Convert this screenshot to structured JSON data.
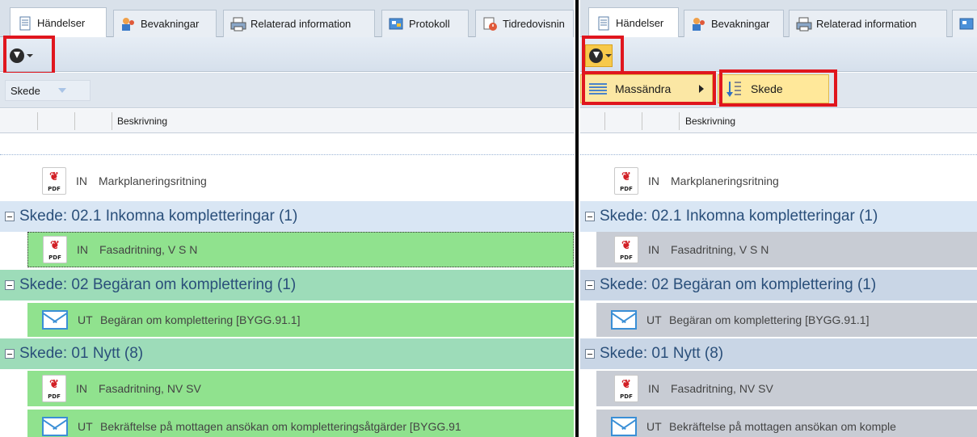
{
  "tabs_left": [
    {
      "label": "Händelser",
      "icon": "events-icon"
    },
    {
      "label": "Bevakningar",
      "icon": "watchers-icon"
    },
    {
      "label": "Relaterad information",
      "icon": "printer-icon"
    },
    {
      "label": "Protokoll",
      "icon": "protocol-icon"
    },
    {
      "label": "Tidredovisnin",
      "icon": "time-report-icon"
    }
  ],
  "tabs_right": [
    {
      "label": "Händelser",
      "icon": "events-icon"
    },
    {
      "label": "Bevakningar",
      "icon": "watchers-icon"
    },
    {
      "label": "Relaterad information",
      "icon": "printer-icon"
    }
  ],
  "group_chip": "Skede",
  "column_header": "Beskrivning",
  "menu": {
    "item1": "Massändra",
    "item2": "Skede"
  },
  "rows_left": [
    {
      "kind": "doc",
      "dir": "IN",
      "text": "Markplaneringsritning"
    },
    {
      "kind": "group",
      "text": "Skede:  02.1 Inkomna kompletteringar (1)"
    },
    {
      "kind": "doc",
      "dir": "IN",
      "text": "Fasadritning, V S N"
    },
    {
      "kind": "group",
      "text": "Skede:  02 Begäran om komplettering (1)"
    },
    {
      "kind": "mail",
      "dir": "UT",
      "text": "Begäran om komplettering [BYGG.91.1]"
    },
    {
      "kind": "group",
      "text": "Skede:  01 Nytt (8)"
    },
    {
      "kind": "doc",
      "dir": "IN",
      "text": "Fasadritning, NV SV"
    },
    {
      "kind": "mail",
      "dir": "UT",
      "text": "Bekräftelse på mottagen ansökan om kompletteringsåtgärder [BYGG.91"
    }
  ],
  "rows_right": [
    {
      "kind": "doc",
      "dir": "IN",
      "text": "Markplaneringsritning"
    },
    {
      "kind": "group",
      "text": "Skede:  02.1 Inkomna kompletteringar (1)"
    },
    {
      "kind": "doc",
      "dir": "IN",
      "text": "Fasadritning, V S N"
    },
    {
      "kind": "group",
      "text": "Skede:  02 Begäran om komplettering (1)"
    },
    {
      "kind": "mail",
      "dir": "UT",
      "text": "Begäran om komplettering [BYGG.91.1]"
    },
    {
      "kind": "group",
      "text": "Skede:  01 Nytt (8)"
    },
    {
      "kind": "doc",
      "dir": "IN",
      "text": "Fasadritning, NV SV"
    },
    {
      "kind": "mail",
      "dir": "UT",
      "text": "Bekräftelse på mottagen ansökan om komple"
    }
  ],
  "pdf_label": "PDF",
  "colors": {
    "highlight_border": "#e0161e",
    "selected_row_left": "#90e28e",
    "selected_row_right": "#c8ccd4",
    "menu_hover": "#ffe89a"
  }
}
